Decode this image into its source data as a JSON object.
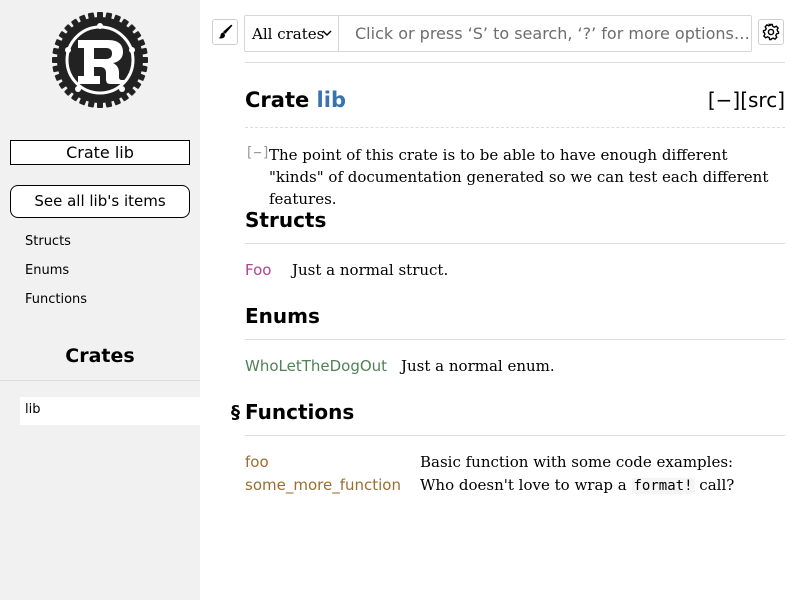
{
  "sidebar": {
    "logo": "rust-logo",
    "crate_label": "Crate lib",
    "see_all_label": "See all lib's items",
    "links": [
      "Structs",
      "Enums",
      "Functions"
    ],
    "crates_heading": "Crates",
    "crates": [
      "lib"
    ]
  },
  "search": {
    "crate_select_value": "All crates",
    "placeholder": "Click or press ‘S’ to search, ‘?’ for more options…"
  },
  "main": {
    "heading_prefix": "Crate",
    "crate_name": "lib",
    "collapse_all": "[−]",
    "src_link": "[src]",
    "doc_toggle": "[−]",
    "doc_text": "The point of this crate is to be able to have enough different \"kinds\" of documentation generated so we can test each different features.",
    "sections": {
      "structs": {
        "title": "Structs",
        "items": [
          {
            "name": "Foo",
            "desc": "Just a normal struct."
          }
        ]
      },
      "enums": {
        "title": "Enums",
        "items": [
          {
            "name": "WhoLetTheDogOut",
            "desc": "Just a normal enum."
          }
        ]
      },
      "functions": {
        "anchor": "§",
        "title": "Functions",
        "items": [
          {
            "name": "foo",
            "desc": "Basic function with some code examples:"
          },
          {
            "name": "some_more_function",
            "desc_before": "Who doesn't love to wrap a",
            "desc_code": "format!",
            "desc_after": "call?"
          }
        ]
      }
    }
  },
  "colors": {
    "sidebar_bg": "#f1f1f1",
    "crate_name": "#3873ad",
    "struct": "#ad448e",
    "enum": "#508157",
    "function": "#9a6e31"
  },
  "icons": [
    "rust-logo",
    "brush-icon",
    "chevron-down-icon",
    "gear-icon"
  ]
}
